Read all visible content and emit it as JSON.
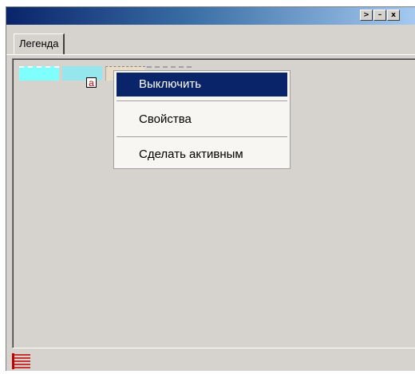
{
  "window": {
    "title": "",
    "buttons": {
      "restore": ">",
      "minimize": "–",
      "close": "x"
    }
  },
  "tabs": [
    {
      "label": "Легенда"
    }
  ],
  "legend": {
    "swatches": [
      {
        "color": "#80ffff",
        "style": "dashed"
      },
      {
        "color": "#96e6ee",
        "style": "solid"
      },
      {
        "color": "#e6dcc8",
        "style": "dashed"
      }
    ],
    "label_marker": "a"
  },
  "context_menu": {
    "items": [
      {
        "label": "Выключить",
        "selected": true
      },
      {
        "label": "Свойства",
        "selected": false
      },
      {
        "label": "Сделать активным",
        "selected": false
      }
    ]
  },
  "status_bar": {
    "icon": "legend-list-icon"
  }
}
